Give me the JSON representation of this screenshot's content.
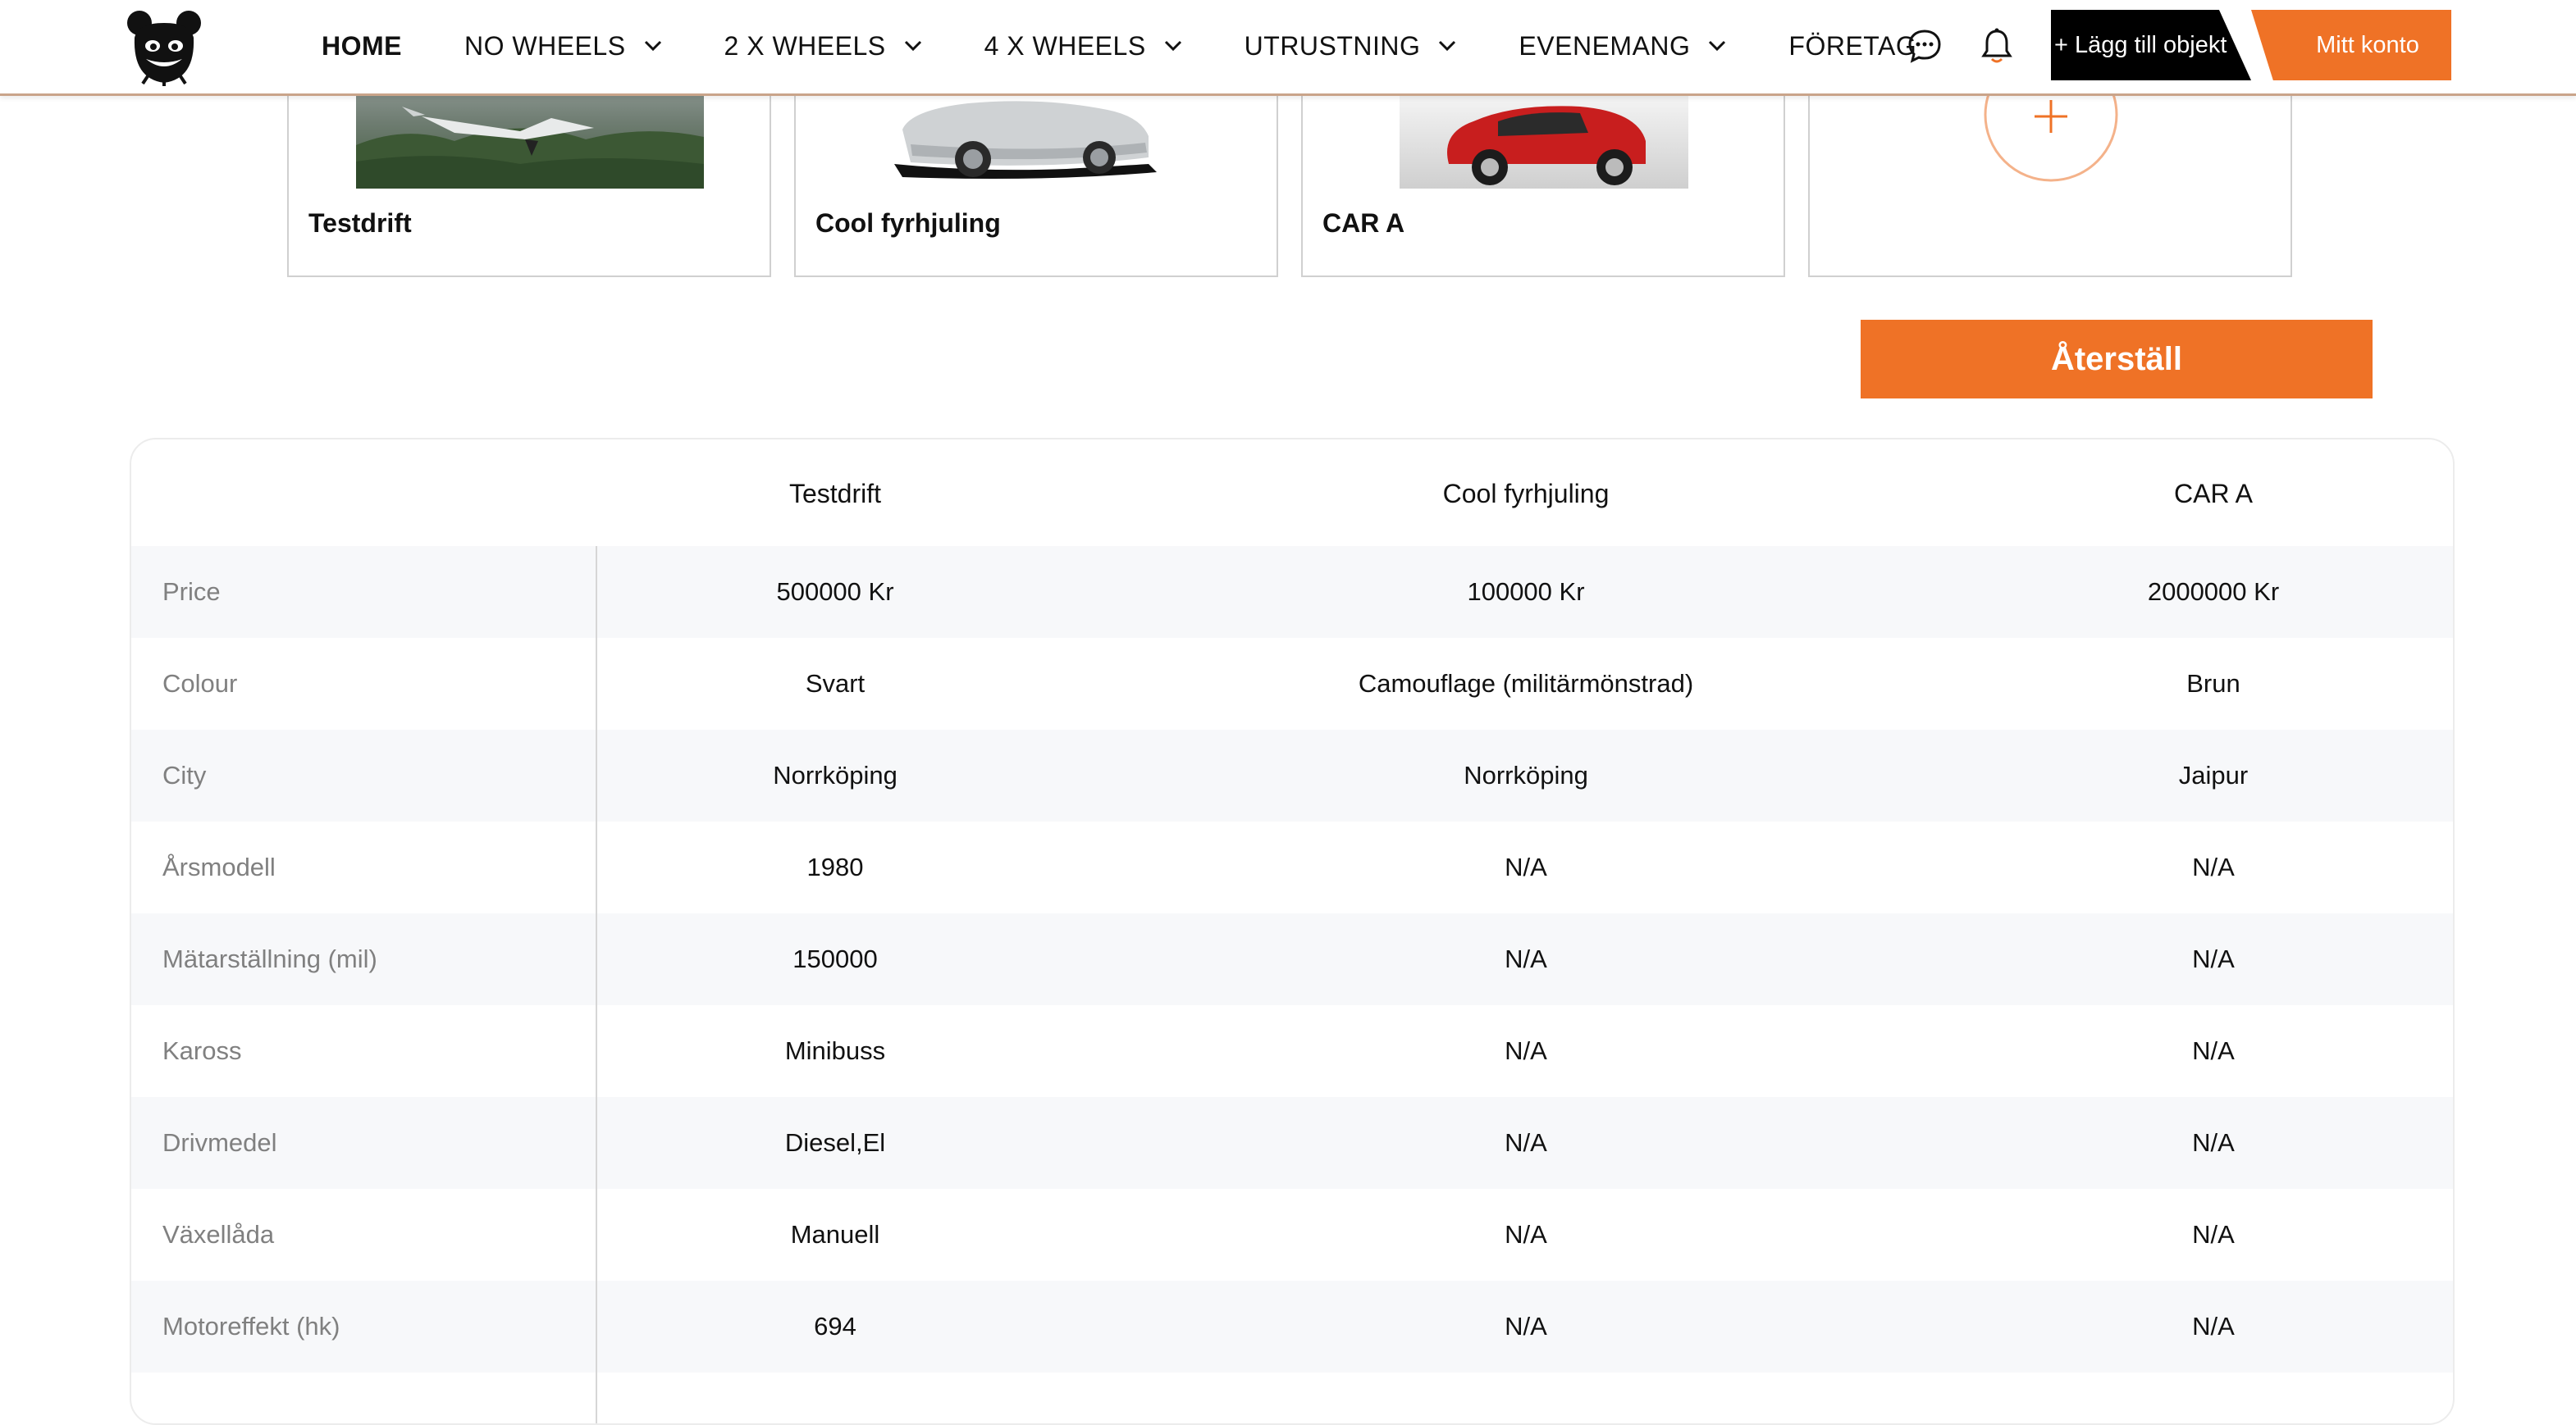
{
  "nav": {
    "items": [
      {
        "label": "HOME",
        "has_dropdown": false,
        "active": true
      },
      {
        "label": "NO WHEELS",
        "has_dropdown": true
      },
      {
        "label": "2 X WHEELS",
        "has_dropdown": true
      },
      {
        "label": "4 X WHEELS",
        "has_dropdown": true
      },
      {
        "label": "UTRUSTNING",
        "has_dropdown": true
      },
      {
        "label": "EVENEMANG",
        "has_dropdown": true
      },
      {
        "label": "FÖRETAG",
        "has_dropdown": false
      }
    ],
    "add_object_label": "+ Lägg till objekt",
    "account_label": "Mitt konto"
  },
  "icons": {
    "logo": "bear-mascot-logo",
    "chat": "chat-bubble-icon",
    "bell": "bell-icon",
    "dropdown": "chevron-down-icon",
    "add": "plus-icon"
  },
  "cards": [
    {
      "name": "Testdrift",
      "image": "aircraft-over-forest"
    },
    {
      "name": "Cool fyrhjuling",
      "image": "silver-car"
    },
    {
      "name": "CAR A",
      "image": "red-small-car"
    }
  ],
  "reset_label": "Återställ",
  "colors": {
    "accent": "#ef7226",
    "black": "#000000",
    "label_gray": "#808080"
  },
  "comparison": {
    "columns": [
      "Testdrift",
      "Cool fyrhjuling",
      "CAR A"
    ],
    "rows": [
      {
        "label": "Price",
        "values": [
          "500000 Kr",
          "100000 Kr",
          "2000000 Kr"
        ]
      },
      {
        "label": "Colour",
        "values": [
          "Svart",
          "Camouflage (militärmönstrad)",
          "Brun"
        ]
      },
      {
        "label": "City",
        "values": [
          "Norrköping",
          "Norrköping",
          "Jaipur"
        ]
      },
      {
        "label": "Årsmodell",
        "values": [
          "1980",
          "N/A",
          "N/A"
        ]
      },
      {
        "label": "Mätarställning (mil)",
        "values": [
          "150000",
          "N/A",
          "N/A"
        ]
      },
      {
        "label": "Kaross",
        "values": [
          "Minibuss",
          "N/A",
          "N/A"
        ]
      },
      {
        "label": "Drivmedel",
        "values": [
          "Diesel,El",
          "N/A",
          "N/A"
        ]
      },
      {
        "label": "Växellåda",
        "values": [
          "Manuell",
          "N/A",
          "N/A"
        ]
      },
      {
        "label": "Motoreffekt (hk)",
        "values": [
          "694",
          "N/A",
          "N/A"
        ]
      }
    ]
  }
}
